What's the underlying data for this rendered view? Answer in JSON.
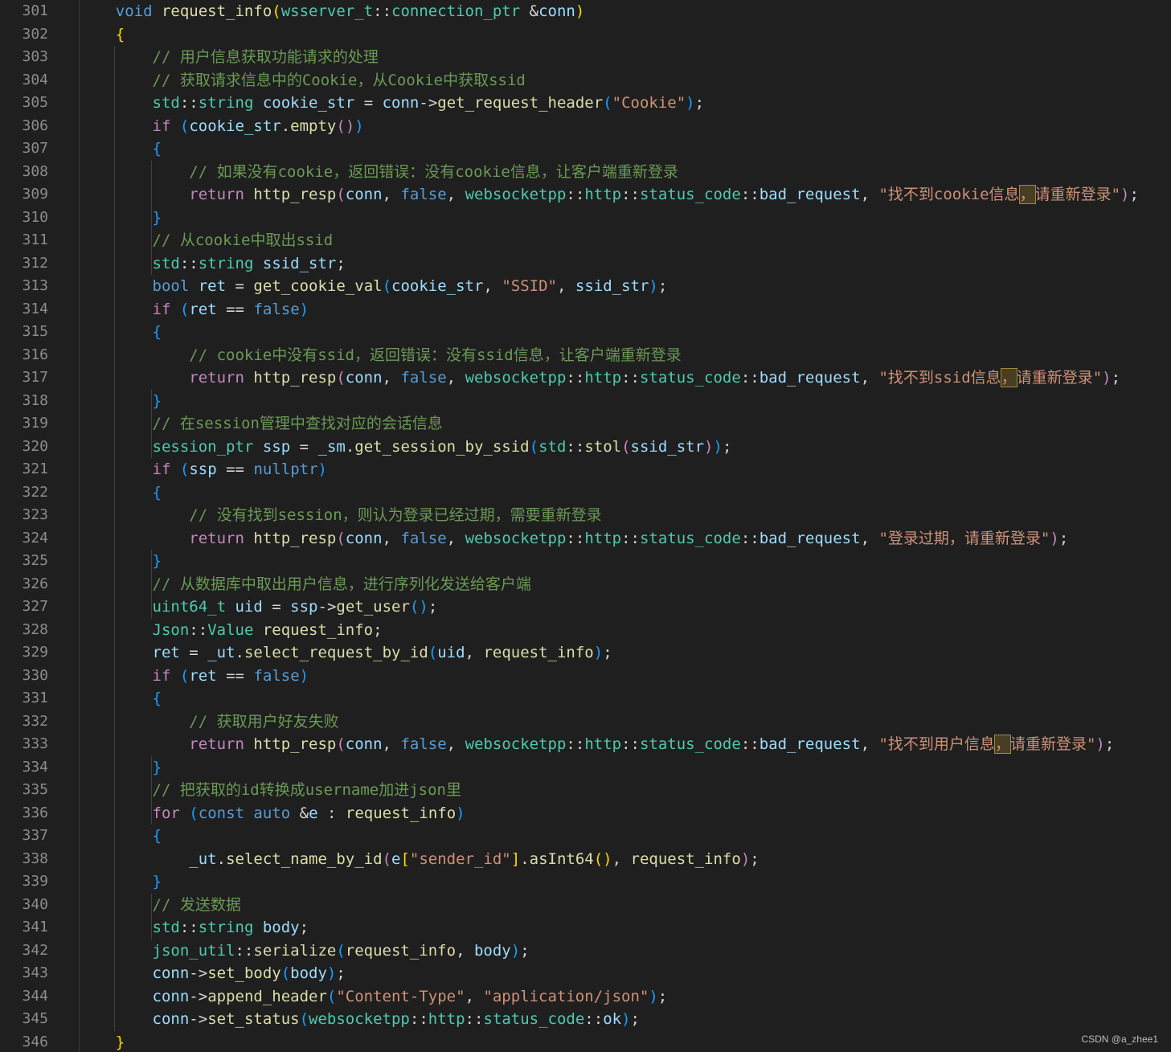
{
  "editor": {
    "language": "cpp",
    "theme": {
      "background": "#1f1f1f",
      "line_number": "#8c8c8c",
      "keyword": "#569cd6",
      "control": "#c586c0",
      "function": "#dcdcaa",
      "type": "#4ec9b0",
      "variable": "#9cdcfe",
      "string": "#ce9178",
      "comment": "#6a9955",
      "punctuation": "#d4d4d4",
      "bracket_gold": "#ffd700",
      "bracket_blue": "#179fff"
    },
    "lines": [
      {
        "n": "301",
        "text": "    void request_info(wsserver_t::connection_ptr &conn)"
      },
      {
        "n": "302",
        "text": "    {"
      },
      {
        "n": "303",
        "text": "        // 用户信息获取功能请求的处理"
      },
      {
        "n": "304",
        "text": "        // 获取请求信息中的Cookie，从Cookie中获取ssid"
      },
      {
        "n": "305",
        "text": "        std::string cookie_str = conn->get_request_header(\"Cookie\");"
      },
      {
        "n": "306",
        "text": "        if (cookie_str.empty())"
      },
      {
        "n": "307",
        "text": "        {"
      },
      {
        "n": "308",
        "text": "            // 如果没有cookie，返回错误：没有cookie信息，让客户端重新登录"
      },
      {
        "n": "309",
        "text": "            return http_resp(conn, false, websocketpp::http::status_code::bad_request, \"找不到cookie信息，请重新登录\");"
      },
      {
        "n": "310",
        "text": "        }"
      },
      {
        "n": "311",
        "text": "        // 从cookie中取出ssid"
      },
      {
        "n": "312",
        "text": "        std::string ssid_str;"
      },
      {
        "n": "313",
        "text": "        bool ret = get_cookie_val(cookie_str, \"SSID\", ssid_str);"
      },
      {
        "n": "314",
        "text": "        if (ret == false)"
      },
      {
        "n": "315",
        "text": "        {"
      },
      {
        "n": "316",
        "text": "            // cookie中没有ssid，返回错误：没有ssid信息，让客户端重新登录"
      },
      {
        "n": "317",
        "text": "            return http_resp(conn, false, websocketpp::http::status_code::bad_request, \"找不到ssid信息，请重新登录\");"
      },
      {
        "n": "318",
        "text": "        }"
      },
      {
        "n": "319",
        "text": "        // 在session管理中查找对应的会话信息"
      },
      {
        "n": "320",
        "text": "        session_ptr ssp = _sm.get_session_by_ssid(std::stol(ssid_str));"
      },
      {
        "n": "321",
        "text": "        if (ssp == nullptr)"
      },
      {
        "n": "322",
        "text": "        {"
      },
      {
        "n": "323",
        "text": "            // 没有找到session，则认为登录已经过期，需要重新登录"
      },
      {
        "n": "324",
        "text": "            return http_resp(conn, false, websocketpp::http::status_code::bad_request, \"登录过期，请重新登录\");"
      },
      {
        "n": "325",
        "text": "        }"
      },
      {
        "n": "326",
        "text": "        // 从数据库中取出用户信息，进行序列化发送给客户端"
      },
      {
        "n": "327",
        "text": "        uint64_t uid = ssp->get_user();"
      },
      {
        "n": "328",
        "text": "        Json::Value request_info;"
      },
      {
        "n": "329",
        "text": "        ret = _ut.select_request_by_id(uid, request_info);"
      },
      {
        "n": "330",
        "text": "        if (ret == false)"
      },
      {
        "n": "331",
        "text": "        {"
      },
      {
        "n": "332",
        "text": "            // 获取用户好友失败"
      },
      {
        "n": "333",
        "text": "            return http_resp(conn, false, websocketpp::http::status_code::bad_request, \"找不到用户信息，请重新登录\");"
      },
      {
        "n": "334",
        "text": "        }"
      },
      {
        "n": "335",
        "text": "        // 把获取的id转换成username加进json里"
      },
      {
        "n": "336",
        "text": "        for (const auto &e : request_info)"
      },
      {
        "n": "337",
        "text": "        {"
      },
      {
        "n": "338",
        "text": "            _ut.select_name_by_id(e[\"sender_id\"].asInt64(), request_info);"
      },
      {
        "n": "339",
        "text": "        }"
      },
      {
        "n": "340",
        "text": "        // 发送数据"
      },
      {
        "n": "341",
        "text": "        std::string body;"
      },
      {
        "n": "342",
        "text": "        json_util::serialize(request_info, body);"
      },
      {
        "n": "343",
        "text": "        conn->set_body(body);"
      },
      {
        "n": "344",
        "text": "        conn->append_header(\"Content-Type\", \"application/json\");"
      },
      {
        "n": "345",
        "text": "        conn->set_status(websocketpp::http::status_code::ok);"
      },
      {
        "n": "346",
        "text": "    }"
      }
    ]
  },
  "watermark": "CSDN @a_zhee1"
}
